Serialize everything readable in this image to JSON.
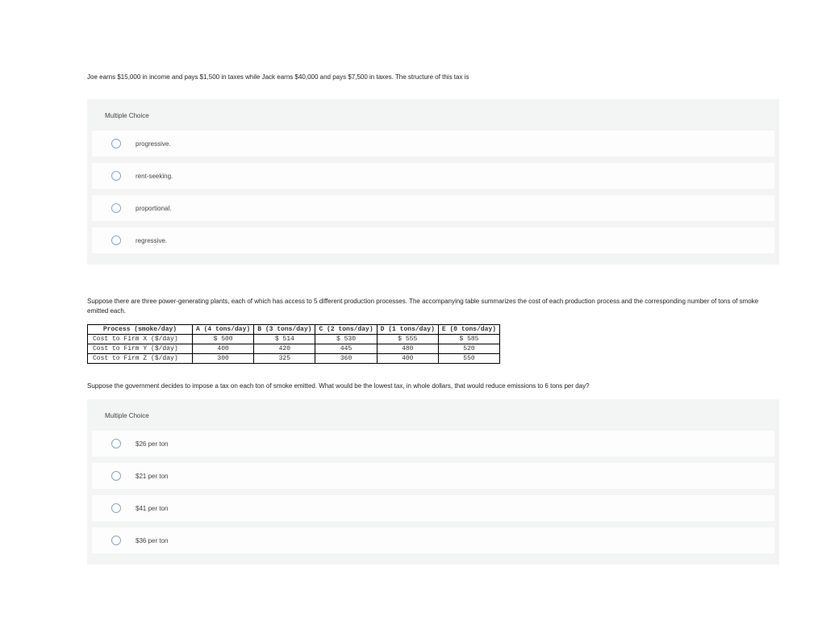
{
  "q1": {
    "prompt": "Joe earns $15,000 in income and pays $1,500 in taxes while Jack earns $40,000 and pays $7,500 in taxes. The structure of this tax is",
    "mc_label": "Multiple Choice",
    "options": [
      "progressive.",
      "rent-seeking.",
      "proportional.",
      "regressive."
    ]
  },
  "q2": {
    "intro": "Suppose there are three power-generating plants, each of which has access to 5 different production processes. The accompanying table summarizes the cost of each production process and the corresponding number of tons of smoke emitted each.",
    "table": {
      "headers": [
        "Process (smoke/day)",
        "A (4 tons/day)",
        "B (3 tons/day)",
        "C (2 tons/day)",
        "D (1 tons/day)",
        "E (0 tons/day)"
      ],
      "rows": [
        {
          "label": "Cost to Firm X ($/day)",
          "vals": [
            "$ 500",
            "$ 514",
            "$ 530",
            "$ 555",
            "$ 585"
          ]
        },
        {
          "label": "Cost to Firm Y ($/day)",
          "vals": [
            "400",
            "420",
            "445",
            "480",
            "520"
          ]
        },
        {
          "label": "Cost to Firm Z ($/day)",
          "vals": [
            "300",
            "325",
            "360",
            "400",
            "550"
          ]
        }
      ]
    },
    "followup": "Suppose the government decides to impose a tax on each ton of smoke emitted. What would be the lowest tax, in whole dollars, that would reduce emissions to 6 tons per day?",
    "mc_label": "Multiple Choice",
    "options": [
      "$26 per ton",
      "$21 per ton",
      "$41 per ton",
      "$36 per ton"
    ]
  }
}
